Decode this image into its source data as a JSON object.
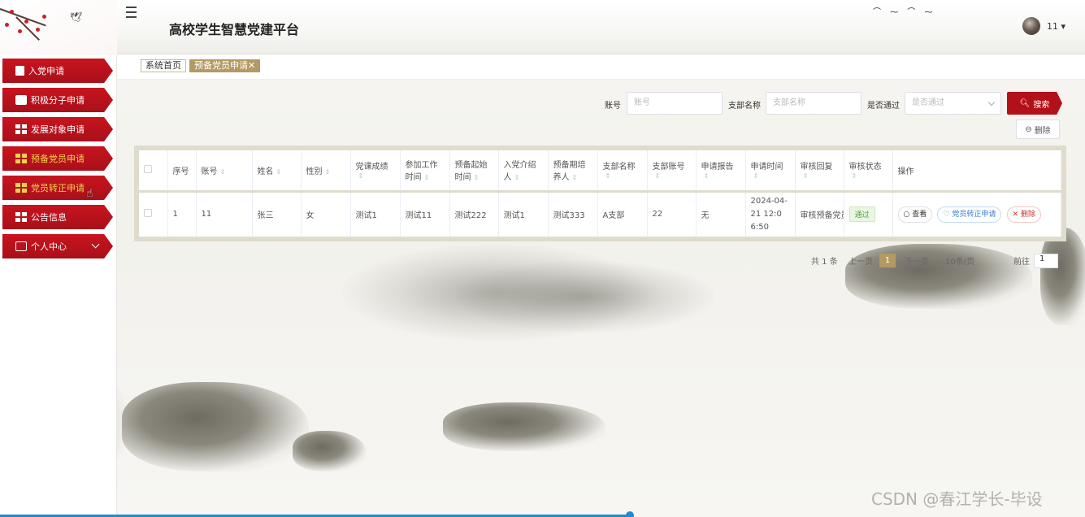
{
  "header": {
    "title": "高校学生智慧党建平台",
    "user_name": "11 ▾"
  },
  "sidebar": {
    "items": [
      {
        "label": "入党申请",
        "icon": "document-icon"
      },
      {
        "label": "积极分子申请",
        "icon": "ticket-icon"
      },
      {
        "label": "发展对象申请",
        "icon": "grid-icon"
      },
      {
        "label": "预备党员申请",
        "icon": "grid-icon"
      },
      {
        "label": "党员转正申请",
        "icon": "grid-icon"
      },
      {
        "label": "公告信息",
        "icon": "grid-icon"
      },
      {
        "label": "个人中心",
        "icon": "calendar-icon"
      }
    ]
  },
  "tabs": {
    "home": "系统首页",
    "current": "预备党员申请✕"
  },
  "search": {
    "account_label": "账号",
    "account_placeholder": "账号",
    "branch_label": "支部名称",
    "branch_placeholder": "支部名称",
    "passed_label": "是否通过",
    "passed_placeholder": "是否通过",
    "search_button": "搜索",
    "delete_button": "删除"
  },
  "table": {
    "headers": [
      "序号",
      "账号",
      "姓名",
      "性别",
      "党课成绩",
      "参加工作时间",
      "预备起始时间",
      "入党介绍人",
      "预备期培养人",
      "支部名称",
      "支部账号",
      "申请报告",
      "申请时间",
      "审核回复",
      "审核状态",
      "操作"
    ],
    "rows": [
      {
        "index": "1",
        "account": "11",
        "name": "张三",
        "gender": "女",
        "score": "测试1",
        "work_time": "测试11",
        "start_time": "测试222",
        "introducer": "测试1",
        "trainer": "测试333",
        "branch": "A支部",
        "branch_account": "22",
        "report": "无",
        "apply_time": "2024-04-21 12:06:50",
        "reply": "审核预备党员",
        "status": "通过",
        "ops": {
          "view": "查看",
          "apply": "党员转正申请",
          "delete": "删除"
        }
      }
    ]
  },
  "pager": {
    "total": "共 1 条",
    "prev": "上一页",
    "current": "1",
    "next": "下一页",
    "page_size": "10条/页",
    "goto": "前往",
    "goto_value": "1"
  },
  "watermark": "CSDN @春江学长-毕设",
  "colors": {
    "accent": "#b3111a",
    "gold": "#b49a62"
  }
}
